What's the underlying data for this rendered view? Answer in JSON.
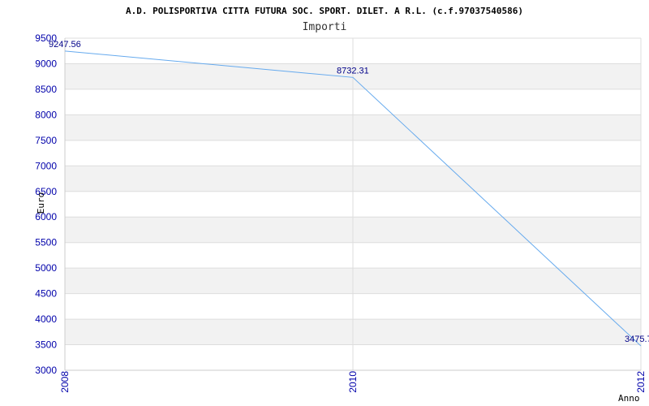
{
  "chart_data": {
    "type": "line",
    "title": "A.D. POLISPORTIVA CITTA FUTURA SOC. SPORT. DILET. A R.L. (c.f.97037540586)",
    "subtitle": "Importi",
    "xlabel": "Anno",
    "ylabel": "Euro",
    "x": [
      "2008",
      "2010",
      "2012"
    ],
    "series": [
      {
        "values": [
          9247.56,
          8732.31,
          3475.7
        ]
      }
    ],
    "data_labels": [
      "9247.56",
      "8732.31",
      "3475.7"
    ],
    "ylim": [
      3000,
      9500
    ],
    "yticks": [
      3000,
      3500,
      4000,
      4500,
      5000,
      5500,
      6000,
      6500,
      7000,
      7500,
      8000,
      8500,
      9000,
      9500
    ],
    "grid": true,
    "grid_style": "alternating horizontal bands",
    "colors": {
      "line": "#66aaee",
      "band": "#f2f2f2",
      "tick": "#0000aa",
      "data_label": "#000088"
    }
  }
}
